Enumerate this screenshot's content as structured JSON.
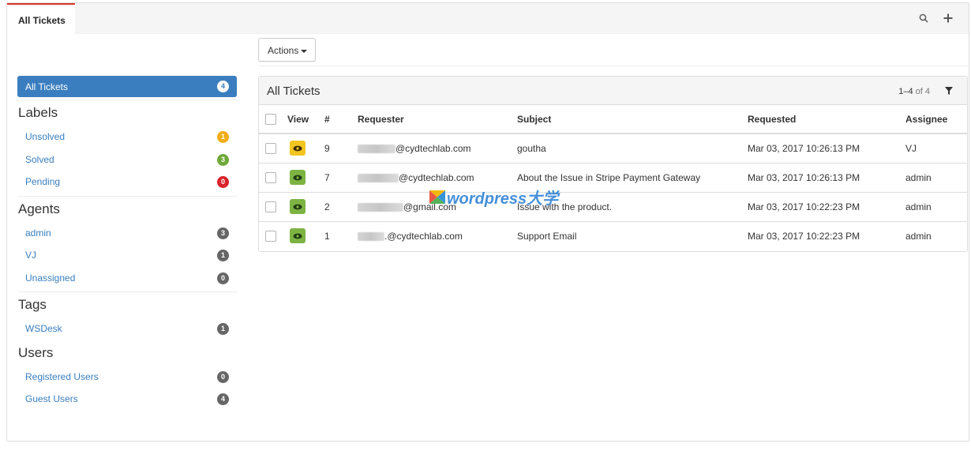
{
  "tabs": [
    {
      "label": "All Tickets",
      "active": true
    }
  ],
  "toolbar": {
    "search_icon": "search-icon",
    "add_icon": "plus-icon"
  },
  "actions": {
    "label": "Actions"
  },
  "sidebar": {
    "all": {
      "label": "All Tickets",
      "count": "4"
    },
    "sections": [
      {
        "heading": "Labels",
        "items": [
          {
            "label": "Unsolved",
            "count": "1",
            "color": "#f0ad18"
          },
          {
            "label": "Solved",
            "count": "3",
            "color": "#6fa93a"
          },
          {
            "label": "Pending",
            "count": "0",
            "color": "#d9232a"
          }
        ]
      },
      {
        "heading": "Agents",
        "items": [
          {
            "label": "admin",
            "count": "3",
            "color": "#666666"
          },
          {
            "label": "VJ",
            "count": "1",
            "color": "#666666"
          },
          {
            "label": "Unassigned",
            "count": "0",
            "color": "#666666"
          }
        ]
      },
      {
        "heading": "Tags",
        "items": [
          {
            "label": "WSDesk",
            "count": "1",
            "color": "#666666"
          }
        ]
      },
      {
        "heading": "Users",
        "items": [
          {
            "label": "Registered Users",
            "count": "0",
            "color": "#666666"
          },
          {
            "label": "Guest Users",
            "count": "4",
            "color": "#666666"
          }
        ]
      }
    ]
  },
  "panel": {
    "title": "All Tickets",
    "pager_range": "1–4",
    "pager_of": "of 4",
    "columns": [
      "View",
      "#",
      "Requester",
      "Subject",
      "Requested",
      "Assignee"
    ],
    "rows": [
      {
        "view_color": "#f2c520",
        "id": "9",
        "requester_domain": "@cydtechlab.com",
        "subject": "goutha",
        "requested": "Mar 03, 2017 10:26:13 PM",
        "assignee": "VJ"
      },
      {
        "view_color": "#7cb342",
        "id": "7",
        "requester_domain": "@cydtechlab.com",
        "subject": "About the Issue in Stripe Payment Gateway",
        "requested": "Mar 03, 2017 10:26:13 PM",
        "assignee": "admin"
      },
      {
        "view_color": "#7cb342",
        "id": "2",
        "requester_domain": "@gmail.com",
        "subject": "Issue with the product.",
        "requested": "Mar 03, 2017 10:22:23 PM",
        "assignee": "admin"
      },
      {
        "view_color": "#7cb342",
        "id": "1",
        "requester_domain": ".@cydtechlab.com",
        "subject": "Support Email",
        "requested": "Mar 03, 2017 10:22:23 PM",
        "assignee": "admin"
      }
    ]
  },
  "watermark": {
    "text": "wordpress大学"
  },
  "colors": {
    "accent": "#3a7ebf",
    "tab_active_border": "#d9342b"
  }
}
